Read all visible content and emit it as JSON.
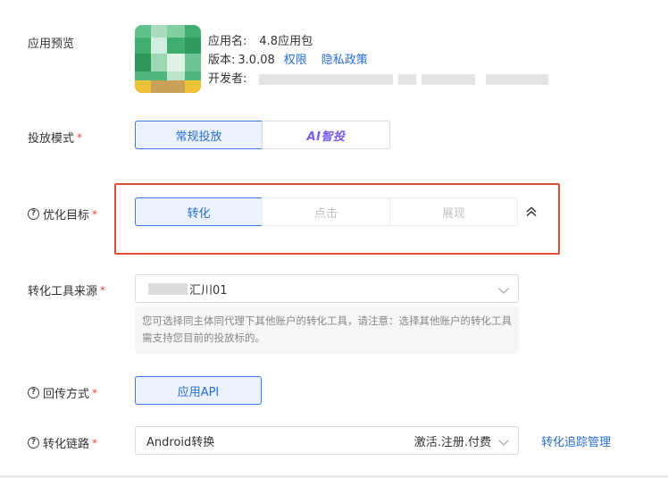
{
  "app_preview": {
    "label": "应用预览",
    "name_label": "应用名:",
    "name_value": "4.8应用包",
    "version_label": "版本:",
    "version_value": "3.0.08",
    "permission_link": "权限",
    "privacy_link": "隐私政策",
    "developer_label": "开发者:"
  },
  "delivery_mode": {
    "label": "投放模式",
    "options": [
      "常规投放",
      "AI智投"
    ],
    "selected": "常规投放"
  },
  "optimization_goal": {
    "label": "优化目标",
    "options": [
      "转化",
      "点击",
      "展现"
    ],
    "selected": "转化"
  },
  "conversion_tool_source": {
    "label": "转化工具来源",
    "value": "汇川01",
    "hint": "您可选择同主体同代理下其他账户的转化工具，请注意：选择其他账户的转化工具需支持您目前的投放标的。"
  },
  "callback_method": {
    "label": "回传方式",
    "value": "应用API"
  },
  "conversion_chain": {
    "label": "转化链路",
    "value": "Android转换",
    "events": "激活.注册.付费",
    "manage_link": "转化追踪管理"
  },
  "colors": {
    "accent": "#2a6fd6",
    "highlight_box": "#e24d3b",
    "required": "#e0483a"
  }
}
